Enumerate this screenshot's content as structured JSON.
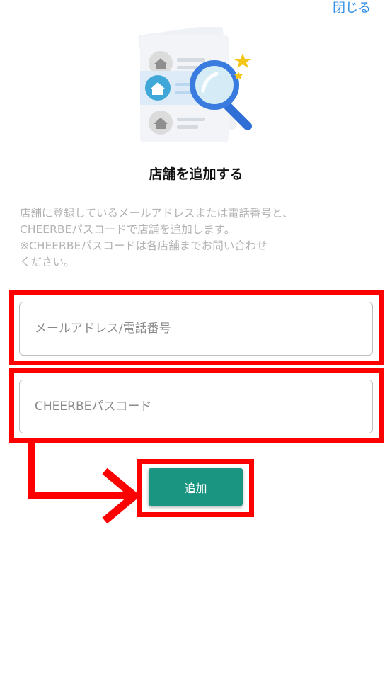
{
  "header": {
    "close_label": "閉じる"
  },
  "illustration": {
    "icon": "store-search-icon"
  },
  "title": "店舗を追加する",
  "description": {
    "line1": "店舗に登録しているメールアドレスまたは電話番号と、",
    "line2": "CHEERBEパスコードで店舗を追加します。",
    "line3": "※CHEERBEパスコードは各店舗までお問い合わせ",
    "line4": "ください。"
  },
  "form": {
    "email_placeholder": "メールアドレス/電話番号",
    "email_value": "",
    "passcode_placeholder": "CHEERBEパスコード",
    "passcode_value": "",
    "submit_label": "追加"
  },
  "colors": {
    "accent": "#1a9582",
    "link": "#2f8ee6",
    "highlight": "#ff0000",
    "muted_text": "#b3b3b3"
  }
}
